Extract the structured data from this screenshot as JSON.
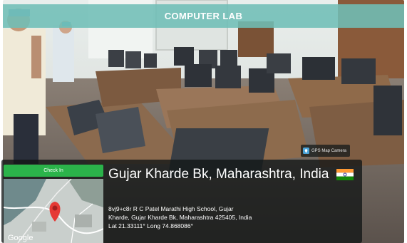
{
  "banner": {
    "title": "COMPUTER LAB"
  },
  "gps_app": {
    "label": "GPS Map Camera"
  },
  "checkin": {
    "label": "Check In"
  },
  "location": {
    "place": "Gujar Kharde Bk, Maharashtra, India",
    "address_line_1": "8vj9+c8r R C Patel Marathi High School, Gujar",
    "address_line_2": "Kharde, Gujar Kharde Bk, Maharashtra 425405, India",
    "coordinates": "Lat 21.33111° Long 74.868086°"
  },
  "map": {
    "attribution": "Google"
  }
}
